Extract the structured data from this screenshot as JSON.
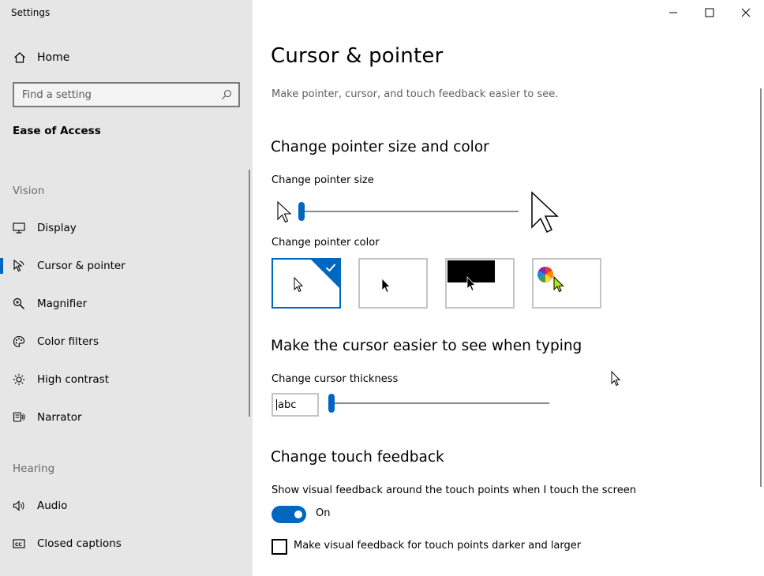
{
  "window": {
    "title": "Settings"
  },
  "sidebar": {
    "home_label": "Home",
    "search_placeholder": "Find a setting",
    "section_title": "Ease of Access",
    "groups": [
      {
        "label": "Vision"
      },
      {
        "label": "Hearing"
      }
    ],
    "items": [
      {
        "label": "Display",
        "icon": "display-icon"
      },
      {
        "label": "Cursor & pointer",
        "icon": "cursor-pointer-icon",
        "active": true
      },
      {
        "label": "Magnifier",
        "icon": "magnifier-icon"
      },
      {
        "label": "Color filters",
        "icon": "palette-icon"
      },
      {
        "label": "High contrast",
        "icon": "brightness-icon"
      },
      {
        "label": "Narrator",
        "icon": "narrator-icon"
      },
      {
        "label": "Audio",
        "icon": "speaker-icon"
      },
      {
        "label": "Closed captions",
        "icon": "captions-icon"
      }
    ]
  },
  "main": {
    "title": "Cursor & pointer",
    "description": "Make pointer, cursor, and touch feedback easier to see.",
    "pointer_section": {
      "heading": "Change pointer size and color",
      "size_label": "Change pointer size",
      "size_level": 0.0,
      "color_label": "Change pointer color",
      "color_options": [
        {
          "name": "white",
          "selected": true
        },
        {
          "name": "black",
          "selected": false
        },
        {
          "name": "inverted",
          "selected": false
        },
        {
          "name": "custom",
          "selected": false
        }
      ]
    },
    "cursor_section": {
      "heading": "Make the cursor easier to see when typing",
      "thickness_label": "Change cursor thickness",
      "preview_text": "abc",
      "thickness_level": 0.0
    },
    "touch_section": {
      "heading": "Change touch feedback",
      "feedback_label": "Show visual feedback around the touch points when I touch the screen",
      "toggle_state": "On",
      "toggle_on": true,
      "darker_label": "Make visual feedback for touch points darker and larger",
      "darker_checked": false
    }
  },
  "colors": {
    "accent": "#0067c0",
    "sidebar_bg": "#e6e6e6"
  }
}
